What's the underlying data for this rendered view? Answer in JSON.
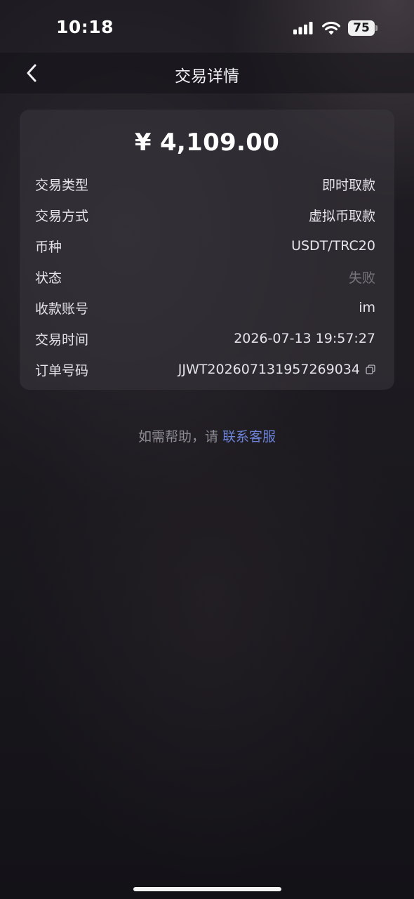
{
  "status_bar": {
    "time": "10:18",
    "battery": "75",
    "signal_icon": "signal-icon",
    "wifi_icon": "wifi-icon"
  },
  "nav": {
    "back_icon": "chevron-left-icon",
    "title": "交易详情"
  },
  "transaction": {
    "amount": "¥ 4,109.00",
    "rows": [
      {
        "label": "交易类型",
        "value": "即时取款"
      },
      {
        "label": "交易方式",
        "value": "虚拟币取款"
      },
      {
        "label": "币种",
        "value": "USDT/TRC20"
      },
      {
        "label": "状态",
        "value": "失败"
      },
      {
        "label": "收款账号",
        "value": "im"
      },
      {
        "label": "交易时间",
        "value": "2026-07-13 19:57:27"
      },
      {
        "label": "订单号码",
        "value": "JJWT202607131957269034"
      }
    ],
    "copy_icon": "copy-icon"
  },
  "help": {
    "prefix": "如需帮助，请 ",
    "link": "联系客服"
  },
  "colors": {
    "accent_link": "#6d83d8",
    "failed_status": "#77767d"
  }
}
